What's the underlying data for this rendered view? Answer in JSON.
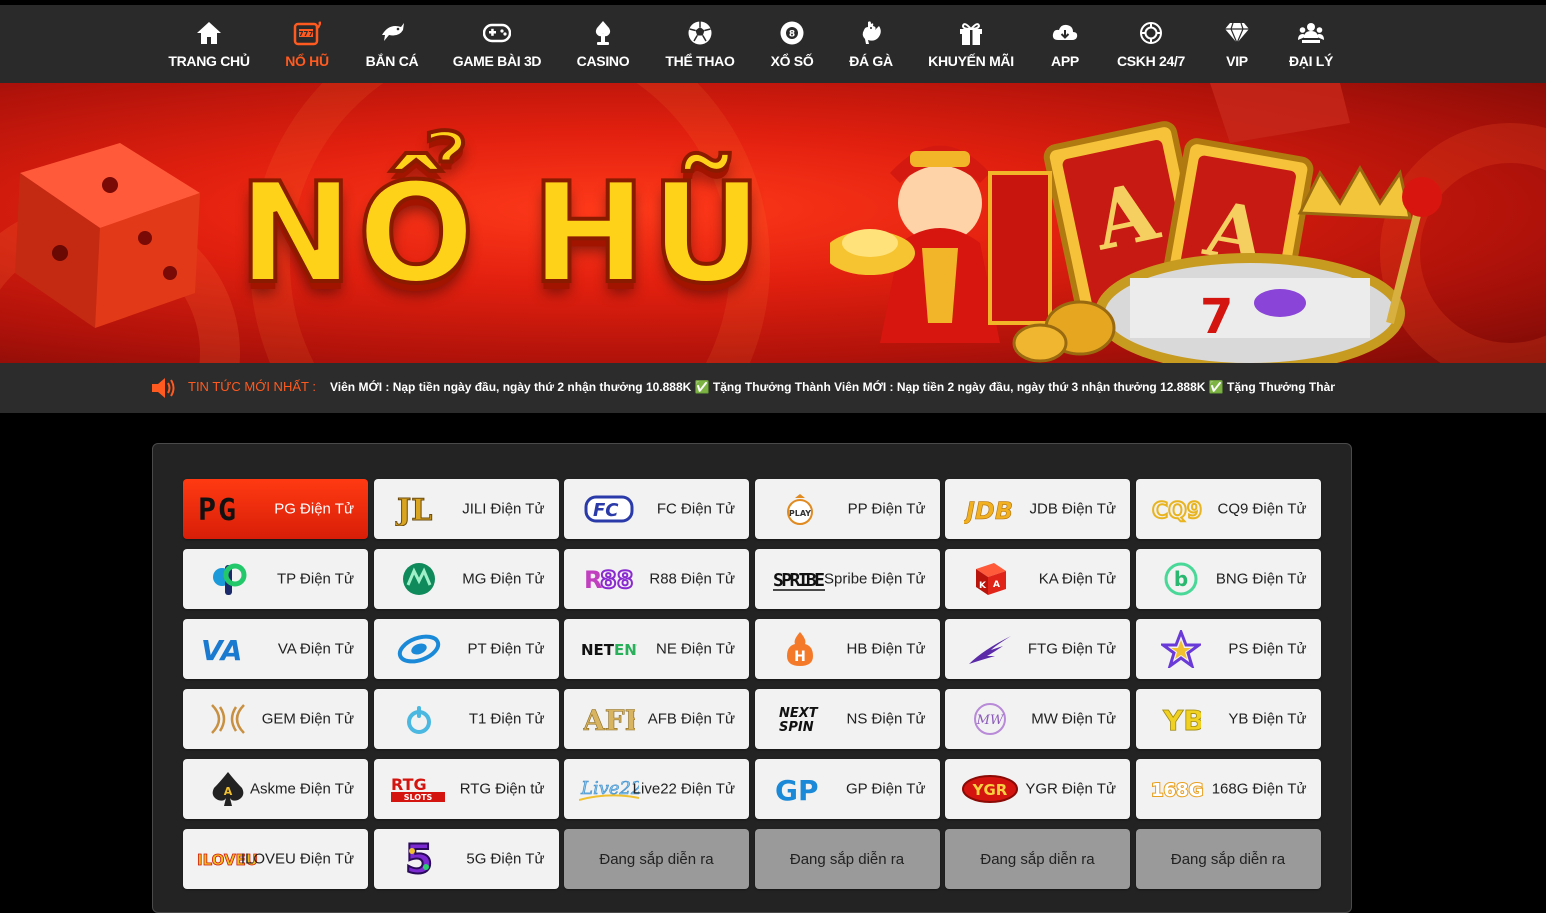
{
  "nav": {
    "items": [
      {
        "label": "TRANG CHỦ",
        "icon": "home-icon"
      },
      {
        "label": "NỔ HŨ",
        "icon": "slot-machine-icon",
        "active": true
      },
      {
        "label": "BẮN CÁ",
        "icon": "fish-icon"
      },
      {
        "label": "GAME BÀI 3D",
        "icon": "gamepad-icon"
      },
      {
        "label": "CASINO",
        "icon": "casino-chip-icon"
      },
      {
        "label": "THỂ THAO",
        "icon": "soccer-ball-icon"
      },
      {
        "label": "XỔ SỐ",
        "icon": "lottery-ball-icon"
      },
      {
        "label": "ĐÁ GÀ",
        "icon": "rooster-icon"
      },
      {
        "label": "KHUYẾN MÃI",
        "icon": "gift-icon"
      },
      {
        "label": "APP",
        "icon": "cloud-download-icon"
      },
      {
        "label": "CSKH 24/7",
        "icon": "support-icon"
      },
      {
        "label": "VIP",
        "icon": "diamond-icon"
      },
      {
        "label": "ĐẠI LÝ",
        "icon": "agent-group-icon"
      }
    ]
  },
  "banner": {
    "title": "NỔ HŨ"
  },
  "news": {
    "label": "TIN TỨC MỚI NHẤT :",
    "text": "Viên MỚI : Nạp tiền ngày đầu, ngày thứ 2 nhận thưởng 10.888K  ✅ Tặng Thưởng Thành Viên MỚI : Nạp tiền 2 ngày đầu, ngày thứ 3 nhận thưởng 12.888K  ✅ Tặng Thưởng Thành Viên"
  },
  "providers": [
    {
      "label": "PG Điện Tử",
      "logo": "PG",
      "active": true
    },
    {
      "label": "JILI Điện Tử",
      "logo": "JL"
    },
    {
      "label": "FC Điện Tử",
      "logo": "FC"
    },
    {
      "label": "PP Điện Tử",
      "logo": "PLAY"
    },
    {
      "label": "JDB Điện Tử",
      "logo": "JDB"
    },
    {
      "label": "CQ9 Điện Tử",
      "logo": "CQ9"
    },
    {
      "label": "TP Điện Tử",
      "logo": "P"
    },
    {
      "label": "MG Điện Tử",
      "logo": "M"
    },
    {
      "label": "R88 Điện Tử",
      "logo": "R88"
    },
    {
      "label": "Spribe Điện Tử",
      "logo": "SPRIBE"
    },
    {
      "label": "KA Điện Tử",
      "logo": "KA"
    },
    {
      "label": "BNG Điện Tử",
      "logo": "b"
    },
    {
      "label": "VA Điện Tử",
      "logo": "VA"
    },
    {
      "label": "PT Điện Tử",
      "logo": "PT"
    },
    {
      "label": "NE Điện Tử",
      "logo": "NETENT"
    },
    {
      "label": "HB Điện Tử",
      "logo": "H"
    },
    {
      "label": "FTG Điện Tử",
      "logo": "FTG"
    },
    {
      "label": "PS Điện Tử",
      "logo": "PS"
    },
    {
      "label": "GEM Điện Tử",
      "logo": "GEM"
    },
    {
      "label": "T1 Điện Tử",
      "logo": "T1"
    },
    {
      "label": "AFB Điện Tử",
      "logo": "AFB"
    },
    {
      "label": "NS Điện Tử",
      "logo": "NEXT SPIN"
    },
    {
      "label": "MW Điện Tử",
      "logo": "MW"
    },
    {
      "label": "YB Điện Tử",
      "logo": "YB"
    },
    {
      "label": "Askme Điện Tử",
      "logo": "A"
    },
    {
      "label": "RTG Điện tử",
      "logo": "RTG SLOTS"
    },
    {
      "label": "Live22 Điện Tử",
      "logo": "Live22"
    },
    {
      "label": "GP Điện Tử",
      "logo": "GP"
    },
    {
      "label": "YGR Điện Tử",
      "logo": "YGR"
    },
    {
      "label": "168G Điện Tử",
      "logo": "168G"
    },
    {
      "label": "ILOVEU Điện Tử",
      "logo": "ILOVEU"
    },
    {
      "label": "5G Điện Tử",
      "logo": "5"
    },
    {
      "label": "Đang sắp diễn ra",
      "soon": true
    },
    {
      "label": "Đang sắp diễn ra",
      "soon": true
    },
    {
      "label": "Đang sắp diễn ra",
      "soon": true
    },
    {
      "label": "Đang sắp diễn ra",
      "soon": true
    }
  ],
  "colors": {
    "accent": "#ff5a1f",
    "nav_bg": "#2a2a2a",
    "tile_bg": "#f2f2f2",
    "soon_bg": "#9a9a9a"
  }
}
